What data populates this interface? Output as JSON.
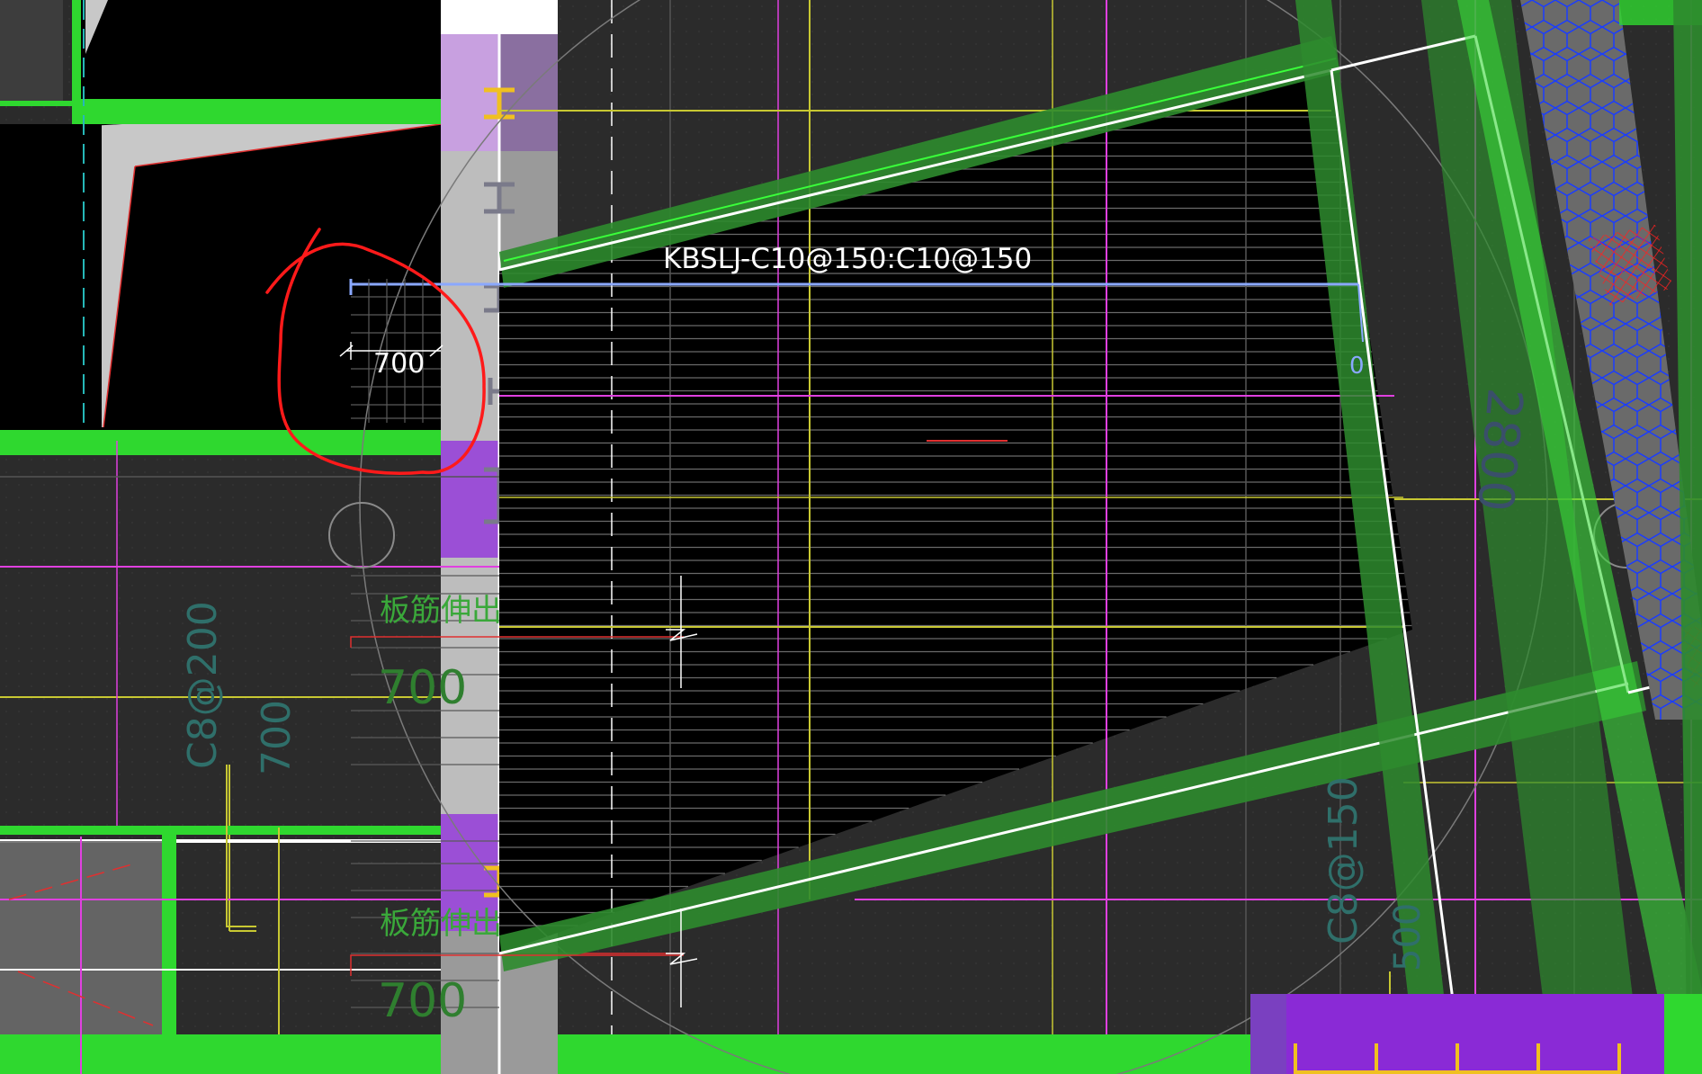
{
  "window": {
    "title": ""
  },
  "labels": {
    "slab_rebar": "KBSLJ-C10@150:C10@150",
    "dim_700_top": "700",
    "dim_zero": "0",
    "dim_2800": "2800",
    "board_ext_1": "板筋伸出",
    "board_ext_2": "板筋伸出",
    "dim_700_a": "700",
    "dim_700_b": "700",
    "dim_700_c": "700",
    "c8_200": "C8@200",
    "c8_150": "C8@150",
    "dim_500": "500"
  },
  "colors": {
    "background": "#2b2b2b",
    "black_area": "#000000",
    "green_beam": "#2fd82f",
    "dark_green_beam": "#2e8b2e",
    "purple": "#9b4fd6",
    "magenta": "#e040e0",
    "yellow": "#c8c832",
    "white_line": "#ffffff",
    "annotation_circle": "#ff1a1a",
    "blue_hex": "#1a3cff",
    "red_hatch": "#e01a1a",
    "teal_text": "#2f6f6a",
    "green_text": "#3aa83a"
  },
  "icons": [
    "i-beam-icon",
    "column-circle-icon",
    "hex-hatch-pattern"
  ]
}
